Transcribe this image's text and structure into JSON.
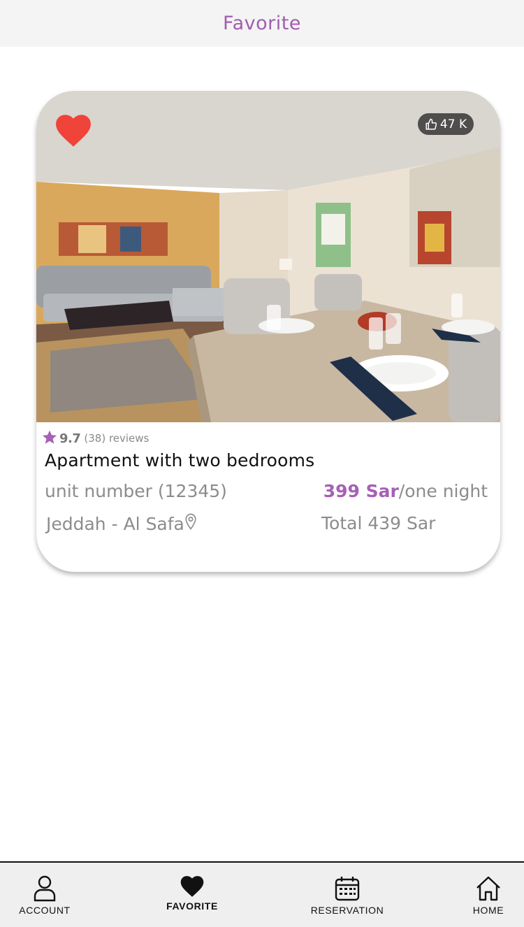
{
  "header": {
    "title": "Favorite"
  },
  "card": {
    "likes": "47 K",
    "rating_score": "9.7",
    "rating_reviews": "(38) reviews",
    "title": "Apartment with two bedrooms",
    "unit": "unit number (12345)",
    "price_amount": "399 Sar",
    "price_suffix": "/one night",
    "location": "Jeddah - Al Safa",
    "total": "Total 439 Sar",
    "is_favorite": true
  },
  "tabs": [
    {
      "label": "ACCOUNT",
      "icon": "user-icon",
      "active": false
    },
    {
      "label": "FAVORITE",
      "icon": "heart-icon",
      "active": true
    },
    {
      "label": "RESERVATION",
      "icon": "calendar-icon",
      "active": false
    },
    {
      "label": "HOME",
      "icon": "home-icon",
      "active": false
    }
  ],
  "colors": {
    "accent": "#a660b5",
    "favorite_heart": "#f0433a",
    "header_bg": "#f4f4f4",
    "tabbar_bg": "#efefef"
  }
}
